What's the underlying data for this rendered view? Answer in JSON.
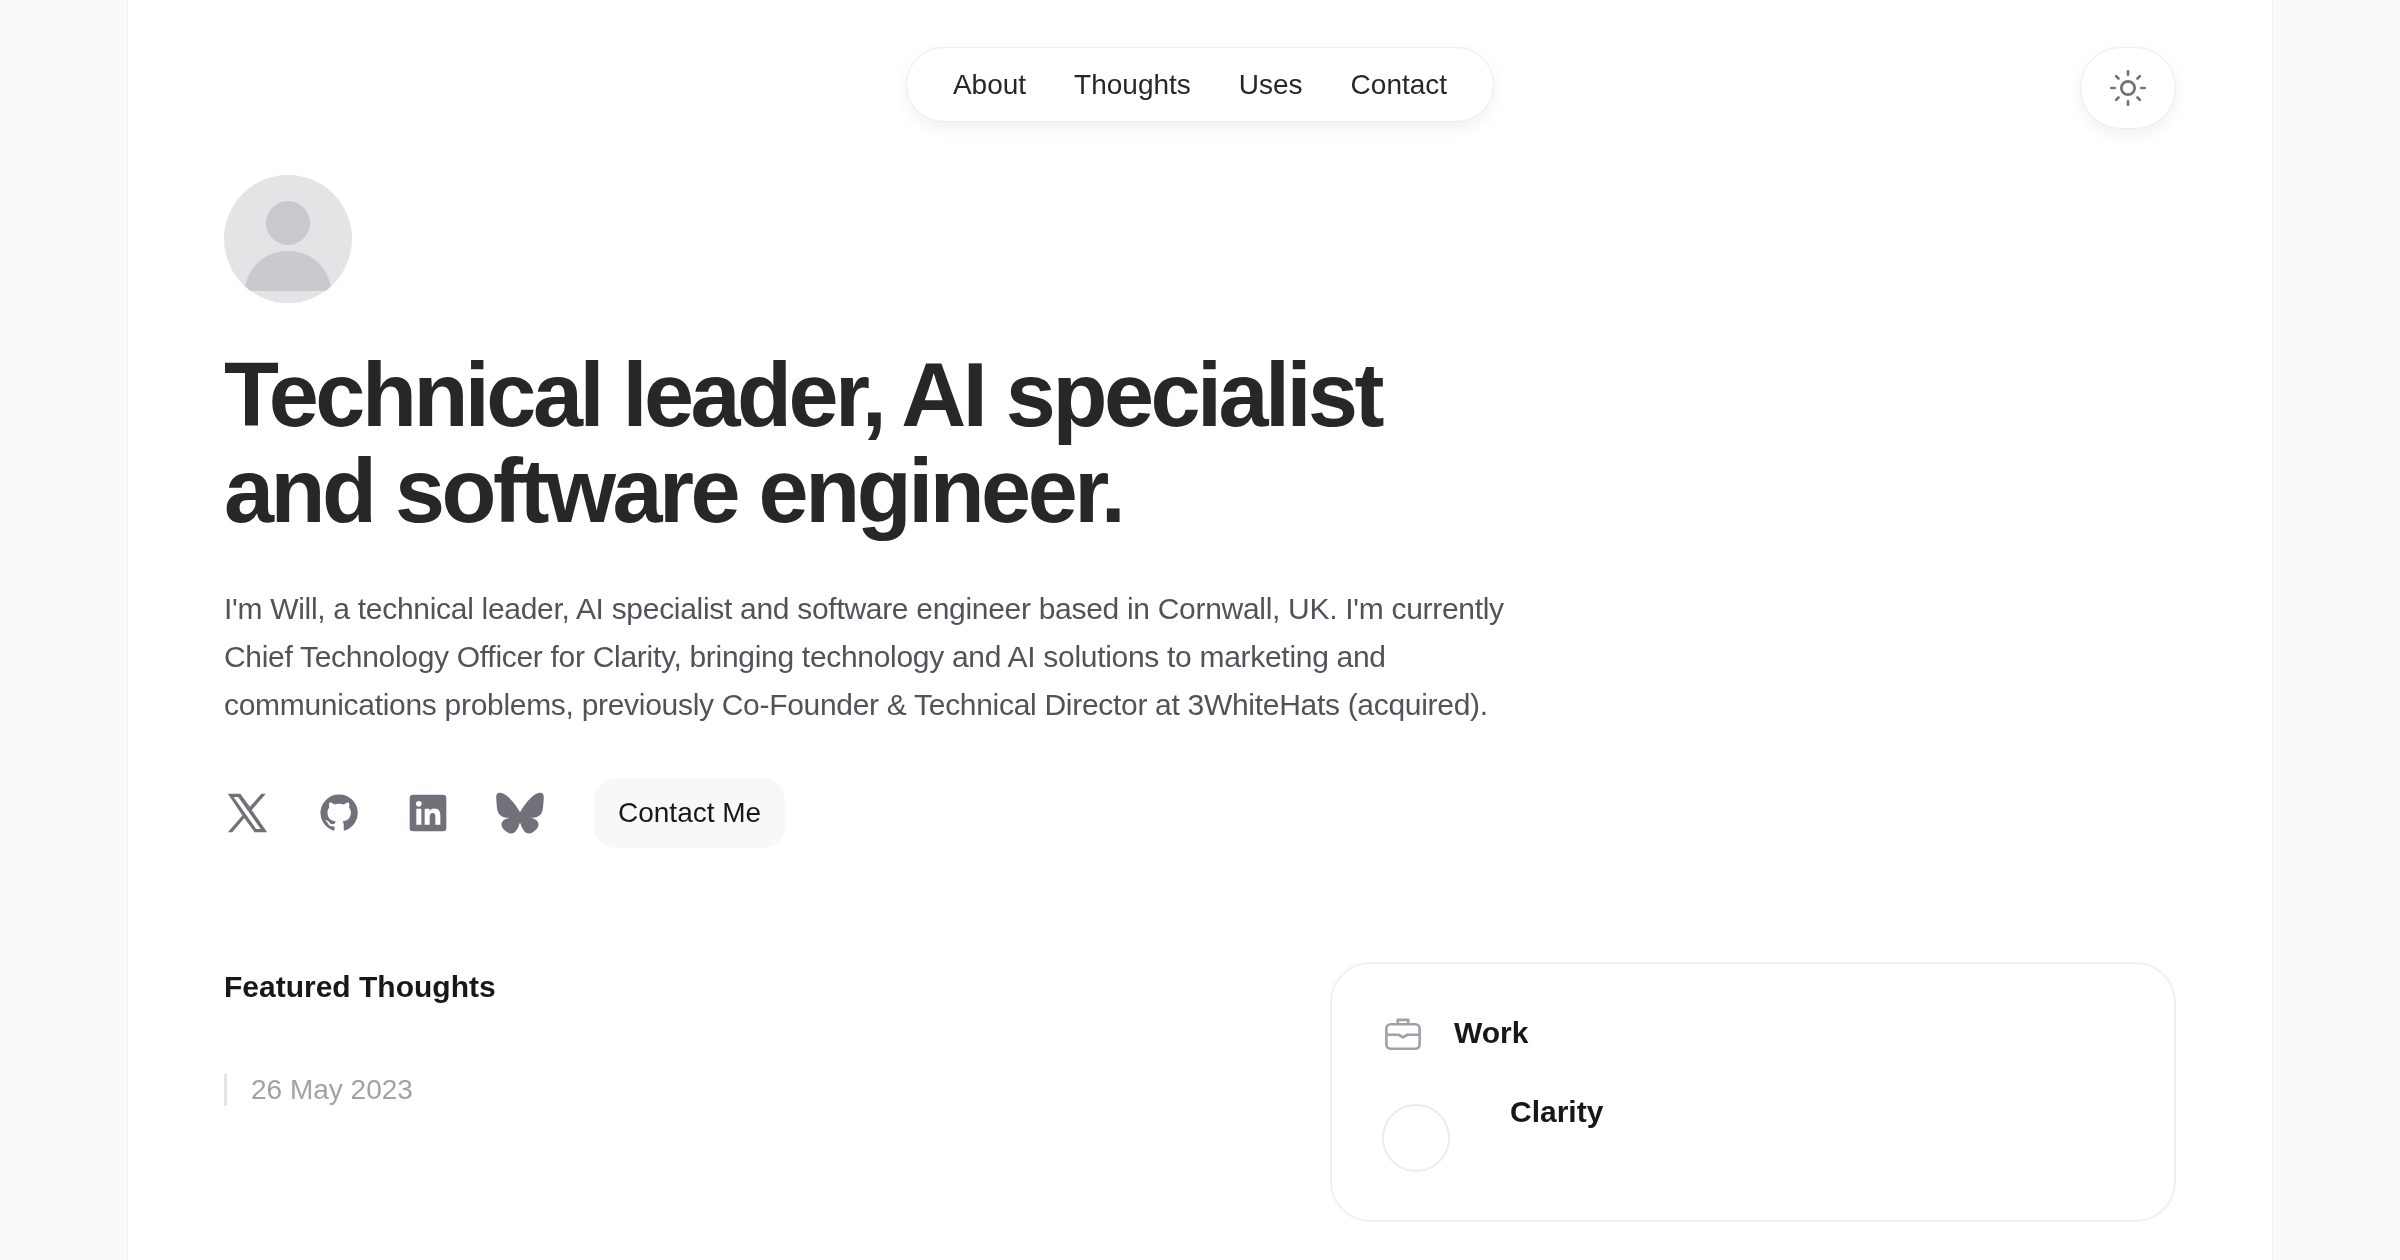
{
  "nav": {
    "items": [
      {
        "label": "About"
      },
      {
        "label": "Thoughts"
      },
      {
        "label": "Uses"
      },
      {
        "label": "Contact"
      }
    ]
  },
  "hero": {
    "heading": "Technical leader, AI specialist and software engineer.",
    "intro": "I'm Will, a technical leader, AI specialist and software engineer based in Cornwall, UK. I'm currently Chief Technology Officer for Clarity, bringing technology and AI solutions to marketing and communications problems, previously Co-Founder & Technical Director at 3WhiteHats (acquired).",
    "social_links": [
      {
        "kind": "x"
      },
      {
        "kind": "github"
      },
      {
        "kind": "linkedin"
      },
      {
        "kind": "bluesky"
      }
    ],
    "contact_button": "Contact Me"
  },
  "featured": {
    "title": "Featured Thoughts",
    "articles": [
      {
        "date": "26 May 2023"
      }
    ]
  },
  "work": {
    "title": "Work",
    "items": [
      {
        "name": "Clarity"
      }
    ]
  }
}
